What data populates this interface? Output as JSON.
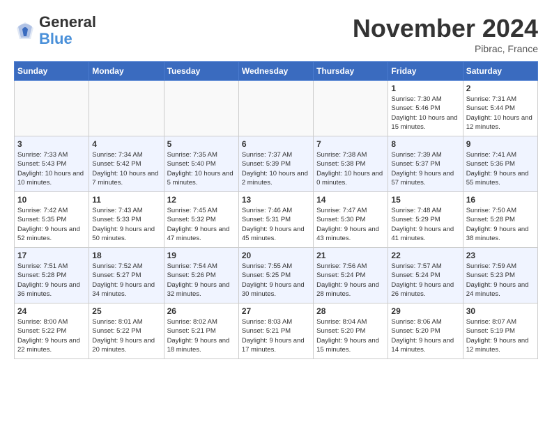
{
  "header": {
    "logo_line1": "General",
    "logo_line2": "Blue",
    "month": "November 2024",
    "location": "Pibrac, France"
  },
  "days_of_week": [
    "Sunday",
    "Monday",
    "Tuesday",
    "Wednesday",
    "Thursday",
    "Friday",
    "Saturday"
  ],
  "weeks": [
    [
      {
        "day": "",
        "info": ""
      },
      {
        "day": "",
        "info": ""
      },
      {
        "day": "",
        "info": ""
      },
      {
        "day": "",
        "info": ""
      },
      {
        "day": "",
        "info": ""
      },
      {
        "day": "1",
        "info": "Sunrise: 7:30 AM\nSunset: 5:46 PM\nDaylight: 10 hours and 15 minutes."
      },
      {
        "day": "2",
        "info": "Sunrise: 7:31 AM\nSunset: 5:44 PM\nDaylight: 10 hours and 12 minutes."
      }
    ],
    [
      {
        "day": "3",
        "info": "Sunrise: 7:33 AM\nSunset: 5:43 PM\nDaylight: 10 hours and 10 minutes."
      },
      {
        "day": "4",
        "info": "Sunrise: 7:34 AM\nSunset: 5:42 PM\nDaylight: 10 hours and 7 minutes."
      },
      {
        "day": "5",
        "info": "Sunrise: 7:35 AM\nSunset: 5:40 PM\nDaylight: 10 hours and 5 minutes."
      },
      {
        "day": "6",
        "info": "Sunrise: 7:37 AM\nSunset: 5:39 PM\nDaylight: 10 hours and 2 minutes."
      },
      {
        "day": "7",
        "info": "Sunrise: 7:38 AM\nSunset: 5:38 PM\nDaylight: 10 hours and 0 minutes."
      },
      {
        "day": "8",
        "info": "Sunrise: 7:39 AM\nSunset: 5:37 PM\nDaylight: 9 hours and 57 minutes."
      },
      {
        "day": "9",
        "info": "Sunrise: 7:41 AM\nSunset: 5:36 PM\nDaylight: 9 hours and 55 minutes."
      }
    ],
    [
      {
        "day": "10",
        "info": "Sunrise: 7:42 AM\nSunset: 5:35 PM\nDaylight: 9 hours and 52 minutes."
      },
      {
        "day": "11",
        "info": "Sunrise: 7:43 AM\nSunset: 5:33 PM\nDaylight: 9 hours and 50 minutes."
      },
      {
        "day": "12",
        "info": "Sunrise: 7:45 AM\nSunset: 5:32 PM\nDaylight: 9 hours and 47 minutes."
      },
      {
        "day": "13",
        "info": "Sunrise: 7:46 AM\nSunset: 5:31 PM\nDaylight: 9 hours and 45 minutes."
      },
      {
        "day": "14",
        "info": "Sunrise: 7:47 AM\nSunset: 5:30 PM\nDaylight: 9 hours and 43 minutes."
      },
      {
        "day": "15",
        "info": "Sunrise: 7:48 AM\nSunset: 5:29 PM\nDaylight: 9 hours and 41 minutes."
      },
      {
        "day": "16",
        "info": "Sunrise: 7:50 AM\nSunset: 5:28 PM\nDaylight: 9 hours and 38 minutes."
      }
    ],
    [
      {
        "day": "17",
        "info": "Sunrise: 7:51 AM\nSunset: 5:28 PM\nDaylight: 9 hours and 36 minutes."
      },
      {
        "day": "18",
        "info": "Sunrise: 7:52 AM\nSunset: 5:27 PM\nDaylight: 9 hours and 34 minutes."
      },
      {
        "day": "19",
        "info": "Sunrise: 7:54 AM\nSunset: 5:26 PM\nDaylight: 9 hours and 32 minutes."
      },
      {
        "day": "20",
        "info": "Sunrise: 7:55 AM\nSunset: 5:25 PM\nDaylight: 9 hours and 30 minutes."
      },
      {
        "day": "21",
        "info": "Sunrise: 7:56 AM\nSunset: 5:24 PM\nDaylight: 9 hours and 28 minutes."
      },
      {
        "day": "22",
        "info": "Sunrise: 7:57 AM\nSunset: 5:24 PM\nDaylight: 9 hours and 26 minutes."
      },
      {
        "day": "23",
        "info": "Sunrise: 7:59 AM\nSunset: 5:23 PM\nDaylight: 9 hours and 24 minutes."
      }
    ],
    [
      {
        "day": "24",
        "info": "Sunrise: 8:00 AM\nSunset: 5:22 PM\nDaylight: 9 hours and 22 minutes."
      },
      {
        "day": "25",
        "info": "Sunrise: 8:01 AM\nSunset: 5:22 PM\nDaylight: 9 hours and 20 minutes."
      },
      {
        "day": "26",
        "info": "Sunrise: 8:02 AM\nSunset: 5:21 PM\nDaylight: 9 hours and 18 minutes."
      },
      {
        "day": "27",
        "info": "Sunrise: 8:03 AM\nSunset: 5:21 PM\nDaylight: 9 hours and 17 minutes."
      },
      {
        "day": "28",
        "info": "Sunrise: 8:04 AM\nSunset: 5:20 PM\nDaylight: 9 hours and 15 minutes."
      },
      {
        "day": "29",
        "info": "Sunrise: 8:06 AM\nSunset: 5:20 PM\nDaylight: 9 hours and 14 minutes."
      },
      {
        "day": "30",
        "info": "Sunrise: 8:07 AM\nSunset: 5:19 PM\nDaylight: 9 hours and 12 minutes."
      }
    ]
  ]
}
